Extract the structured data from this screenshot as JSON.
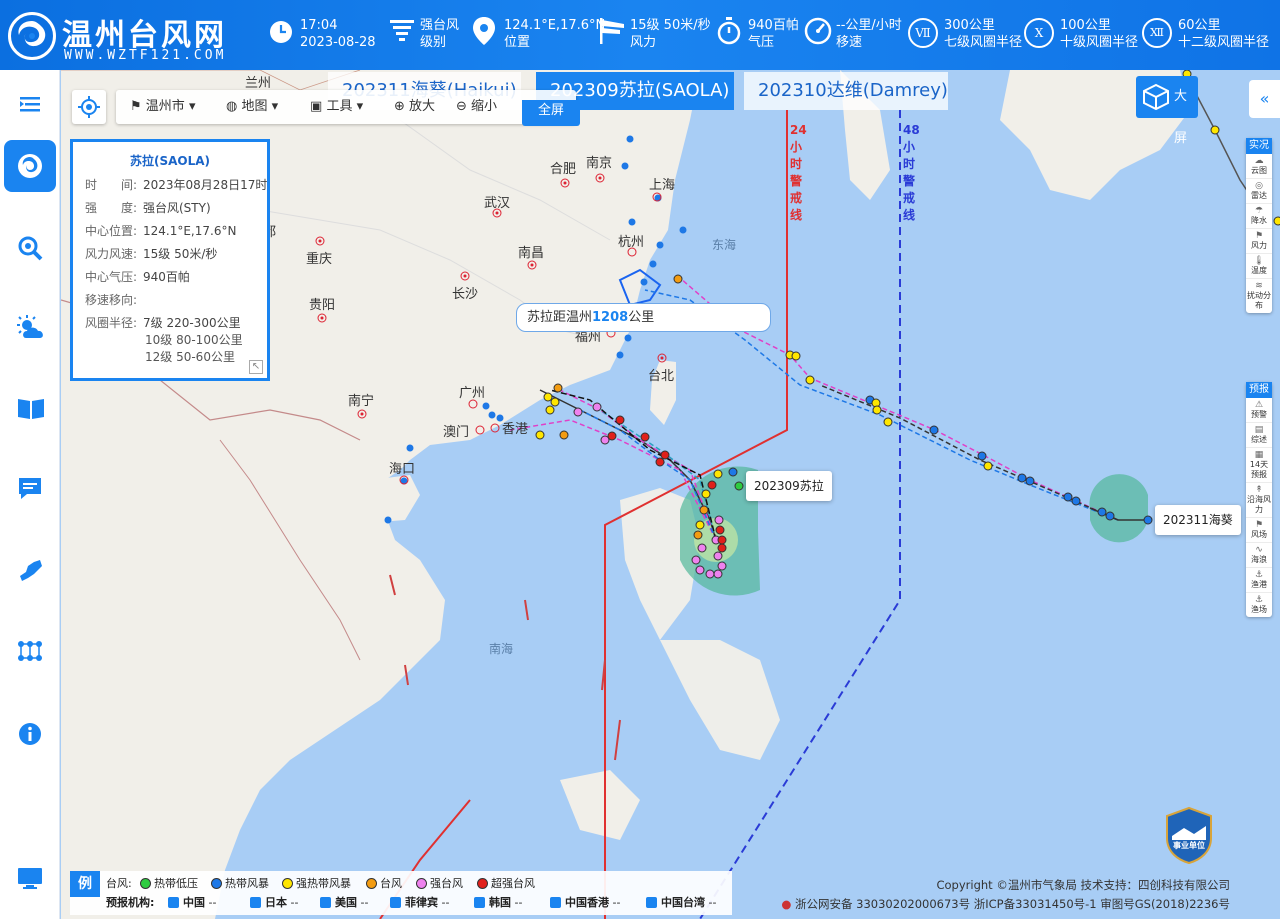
{
  "header": {
    "logo_title": "温州台风网",
    "logo_url": "WWW.WZTF121.COM",
    "time": "17:04",
    "date": "2023-08-28",
    "level_value": "强台风",
    "level_label": "级别",
    "position_value": "124.1°E,17.6°N",
    "position_label": "位置",
    "wind_value": "15级 50米/秒",
    "wind_label": "风力",
    "pressure_value": "940百帕",
    "pressure_label": "气压",
    "speed_value": "--公里/小时",
    "speed_label": "移速",
    "r7_mark": "Ⅶ",
    "r7_value": "300公里",
    "r7_label": "七级风圈半径",
    "r10_mark": "Ⅹ",
    "r10_value": "100公里",
    "r10_label": "十级风圈半径",
    "r12_mark": "Ⅻ",
    "r12_value": "60公里",
    "r12_label": "十二级风圈半径"
  },
  "tabs": [
    {
      "label": "202311海葵(Haikui)"
    },
    {
      "label": "202309苏拉(SAOLA)"
    },
    {
      "label": "202310达维(Damrey)"
    }
  ],
  "toolbar": {
    "city": "温州市",
    "map": "地图",
    "tools": "工具",
    "zoom_in": "放大",
    "zoom_out": "缩小",
    "fullscreen": "全屏"
  },
  "info_panel": {
    "title": "苏拉(SAOLA)",
    "rows": [
      {
        "key": "时　　间:",
        "value": "2023年08月28日17时"
      },
      {
        "key": "强　　度:",
        "value": "强台风(STY)"
      },
      {
        "key": "中心位置:",
        "value": "124.1°E,17.6°N"
      },
      {
        "key": "风力风速:",
        "value": "15级 50米/秒"
      },
      {
        "key": "中心气压:",
        "value": "940百帕"
      },
      {
        "key": "移速移向:",
        "value": ""
      },
      {
        "key": "风圈半径:",
        "value": "7级 220-300公里"
      }
    ],
    "radius_extra": [
      "10级 80-100公里",
      "12级 50-60公里"
    ]
  },
  "distance_popup": {
    "prefix": "苏拉距温州",
    "value": "1208",
    "suffix": "公里"
  },
  "typhoon_labels": {
    "saola": "202309苏拉",
    "haikui": "202311海葵"
  },
  "warning_lines": {
    "line24": "24小时警戒线",
    "line48": "48小时警戒线"
  },
  "map_labels": {
    "cities": [
      "兰州",
      "合肥",
      "南京",
      "上海",
      "武汉",
      "杭州",
      "重庆",
      "南昌",
      "长沙",
      "贵阳",
      "福州",
      "台北",
      "广州",
      "南宁",
      "澳门",
      "香港",
      "海口",
      "都"
    ],
    "seas": [
      "东海",
      "南海"
    ]
  },
  "bigscreen": "大屏",
  "collapse": "«",
  "right_panel_live": {
    "title": "实况",
    "items": [
      {
        "icon": "cloud-chart-icon",
        "glyph": "☁",
        "label": "云图"
      },
      {
        "icon": "radar-icon",
        "glyph": "◎",
        "label": "雷达"
      },
      {
        "icon": "rain-icon",
        "glyph": "☂",
        "label": "降水"
      },
      {
        "icon": "wind-icon",
        "glyph": "⚑",
        "label": "风力"
      },
      {
        "icon": "temperature-icon",
        "glyph": "🌡",
        "label": "温度"
      },
      {
        "icon": "disturbance-icon",
        "glyph": "≋",
        "label": "扰动分布"
      }
    ]
  },
  "right_panel_forecast": {
    "title": "预报",
    "items": [
      {
        "icon": "warning-icon",
        "glyph": "⚠",
        "label": "预警"
      },
      {
        "icon": "summary-icon",
        "glyph": "▤",
        "label": "综述"
      },
      {
        "icon": "forecast-14-icon",
        "glyph": "▦",
        "label": "14天预报"
      },
      {
        "icon": "coast-wind-icon",
        "glyph": "↟",
        "label": "沿海风力"
      },
      {
        "icon": "wind-field-icon",
        "glyph": "⚑",
        "label": "风场"
      },
      {
        "icon": "wave-icon",
        "glyph": "∿",
        "label": "海浪"
      },
      {
        "icon": "port-icon",
        "glyph": "⚓",
        "label": "渔港"
      },
      {
        "icon": "fishing-icon",
        "glyph": "⚓",
        "label": "渔场"
      }
    ]
  },
  "legend": {
    "tag": "例",
    "typhoon_label": "台风:",
    "levels": [
      {
        "label": "热带低压",
        "color": "#2ecc40"
      },
      {
        "label": "热带风暴",
        "color": "#1e78e6"
      },
      {
        "label": "强热带风暴",
        "color": "#ffe600"
      },
      {
        "label": "台风",
        "color": "#f39c12"
      },
      {
        "label": "强台风",
        "color": "#ee82ee"
      },
      {
        "label": "超强台风",
        "color": "#e0201b"
      }
    ],
    "agency_label": "预报机构:",
    "agencies": [
      {
        "label": "中国",
        "color": "#e0201b"
      },
      {
        "label": "日本",
        "color": "#e040c8"
      },
      {
        "label": "美国",
        "color": "#333333"
      },
      {
        "label": "菲律宾",
        "color": "#1e78e6"
      },
      {
        "label": "韩国",
        "color": "#2aa0c0"
      },
      {
        "label": "中国香港",
        "color": "#333333"
      },
      {
        "label": "中国台湾",
        "color": "#333333"
      }
    ],
    "dash": "--"
  },
  "footer": {
    "copyright": "Copyright ©温州市气象局 技术支持：四创科技有限公司",
    "icp": "浙公网安备 33030202000673号  浙ICP备33031450号-1  审图号GS(2018)2236号"
  },
  "logo_badge": "事业单位",
  "colors": {
    "accent": "#1a84f0",
    "sea": "#a8cdf5",
    "land": "#f1efe9",
    "warn24": "#e03030",
    "warn48": "#2a3bd6"
  }
}
